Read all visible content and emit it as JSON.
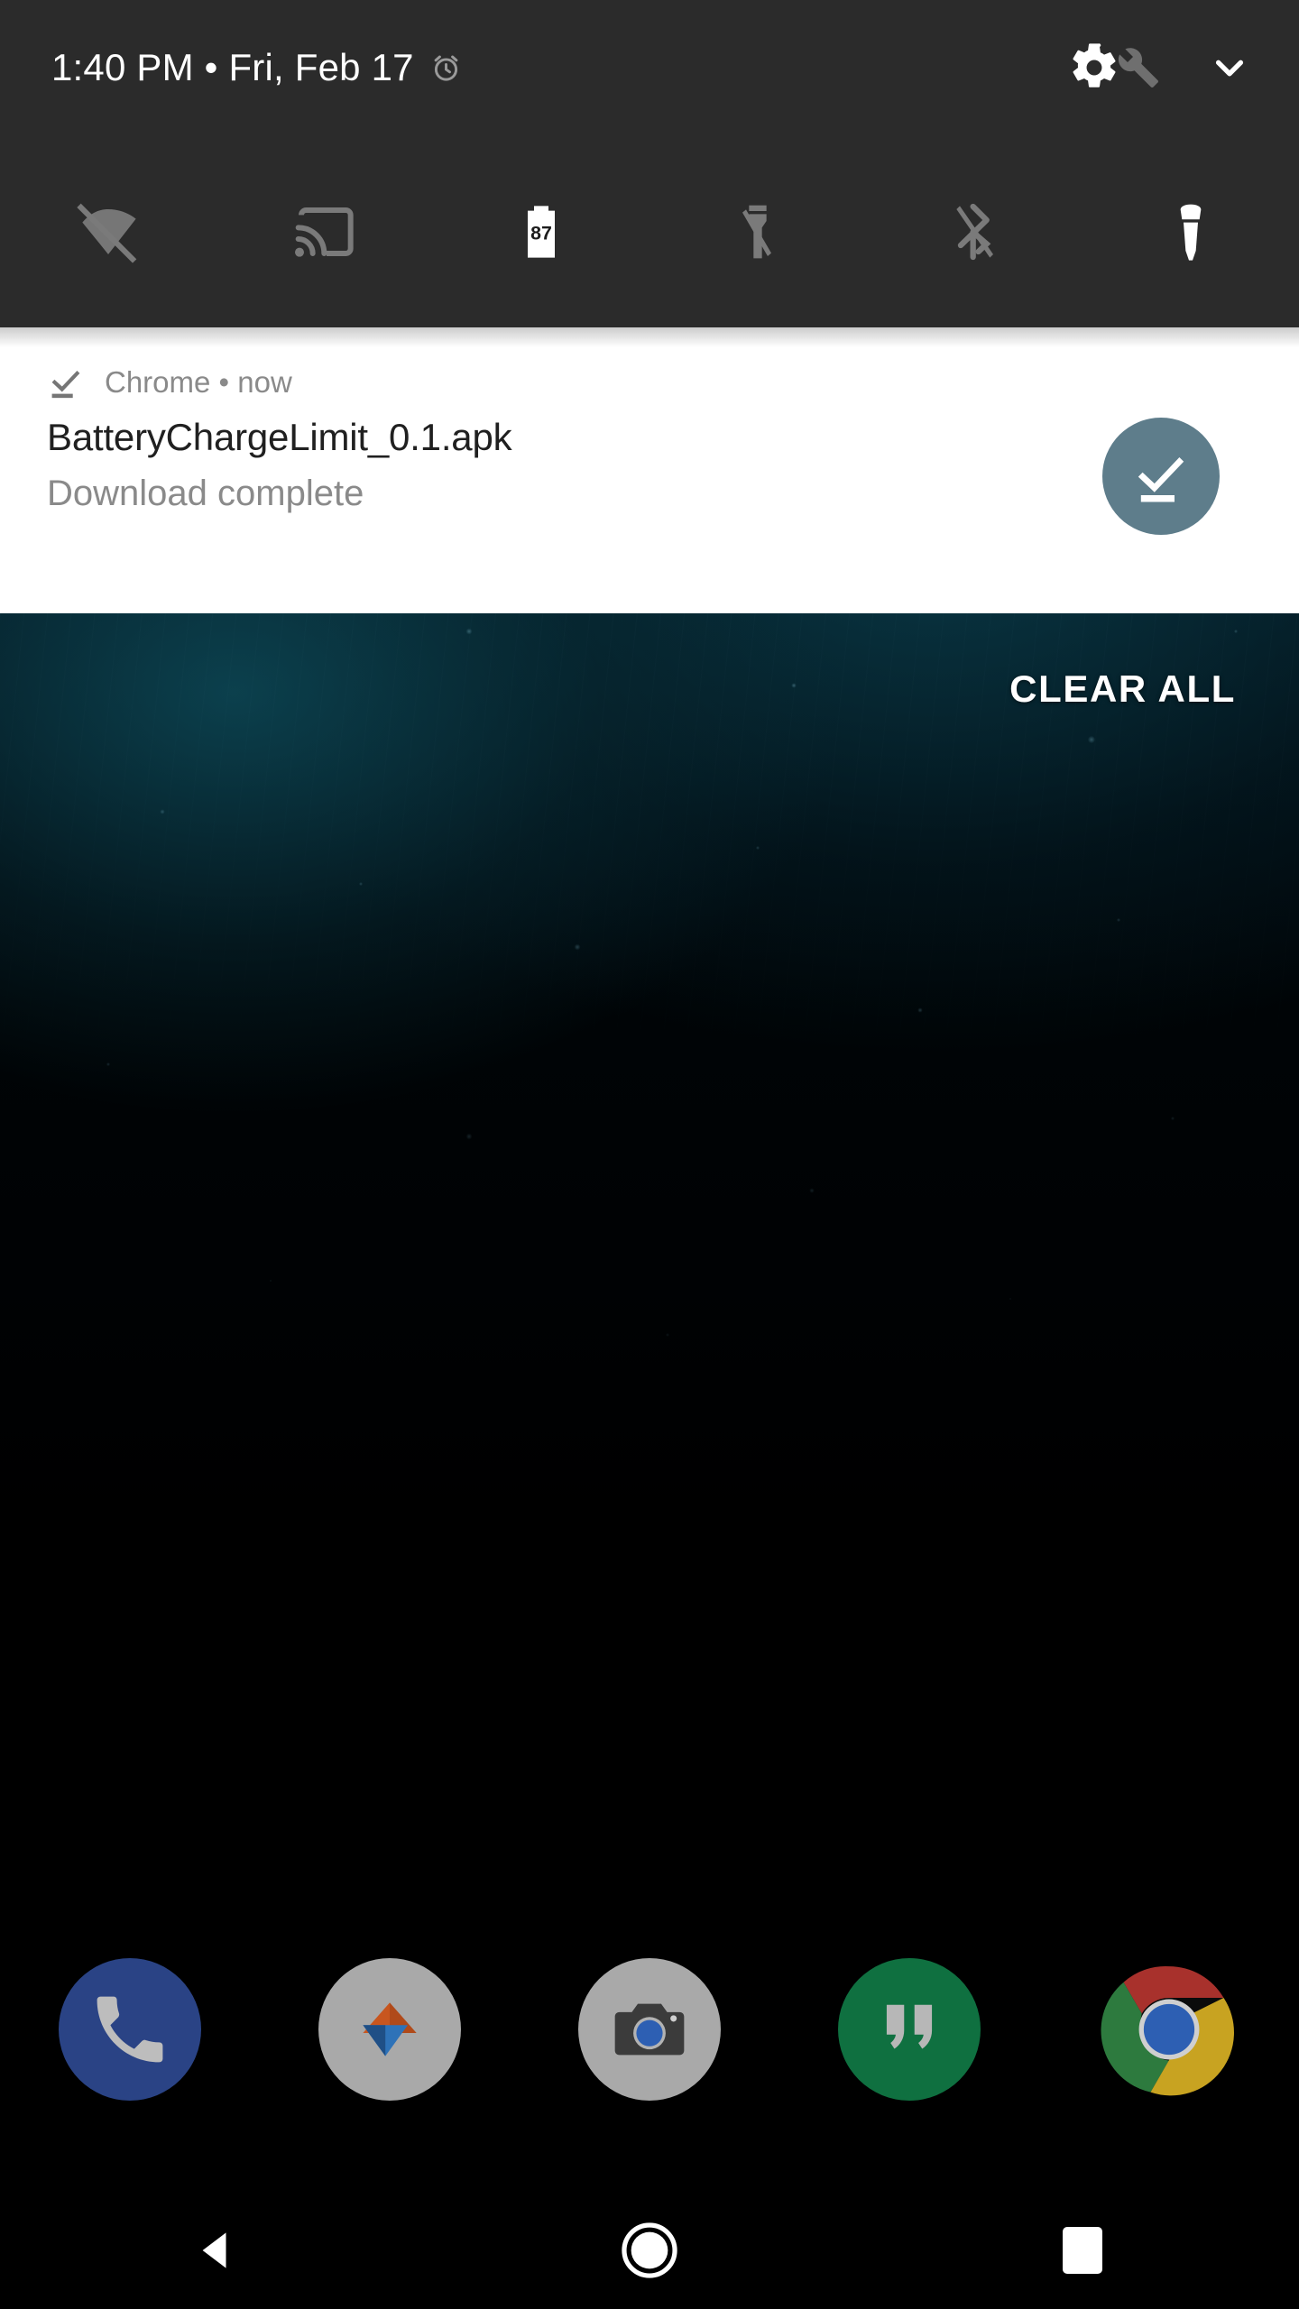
{
  "status_bar": {
    "clock": "1:40 PM • Fri, Feb 17",
    "alarm_icon": "alarm-clock-icon",
    "settings_icon": "gear-icon",
    "tuner_icon": "wrench-icon",
    "expand_icon": "chevron-down-icon",
    "text_color": "#ffffff",
    "background": "#2b2b2b"
  },
  "quick_settings": {
    "icons": [
      {
        "name": "wifi-off-icon",
        "label": "Wi-Fi off",
        "active": false,
        "color": "#7a7a7a"
      },
      {
        "name": "cast-icon",
        "label": "Cast",
        "active": false,
        "color": "#7a7a7a"
      },
      {
        "name": "battery-icon",
        "label": "Battery",
        "active": true,
        "color": "#ffffff",
        "value": "87"
      },
      {
        "name": "flashlight-off-icon",
        "label": "Flashlight off",
        "active": false,
        "color": "#7a7a7a"
      },
      {
        "name": "bluetooth-off-icon",
        "label": "Bluetooth off",
        "active": false,
        "color": "#7a7a7a"
      },
      {
        "name": "flashlight-on-icon",
        "label": "Flashlight on",
        "active": true,
        "color": "#ffffff"
      }
    ]
  },
  "notification": {
    "small_icon": "download-complete-icon",
    "app_line": "Chrome • now",
    "app_name": "Chrome",
    "time": "now",
    "title": "BatteryChargeLimit_0.1.apk",
    "text": "Download complete",
    "badge_icon": "download-complete-icon",
    "badge_color": "#5e7d8b",
    "card_background": "#ffffff",
    "title_color": "#202020",
    "text_color": "#8a8a8a"
  },
  "shade": {
    "clear_all_label": "CLEAR ALL"
  },
  "dock": {
    "items": [
      {
        "name": "dock-item-phone",
        "label": "Phone",
        "icon": "phone-icon",
        "bg": "#2a4385"
      },
      {
        "name": "dock-item-solid-explorer",
        "label": "Solid Explorer",
        "icon": "triangles-icon",
        "bg": "#a9a9a9"
      },
      {
        "name": "dock-item-camera",
        "label": "Camera",
        "icon": "camera-icon",
        "bg": "#a9a9a9"
      },
      {
        "name": "dock-item-hangouts",
        "label": "Hangouts",
        "icon": "quote-icon",
        "bg": "#0f7040"
      },
      {
        "name": "dock-item-chrome",
        "label": "Chrome",
        "icon": "chrome-icon",
        "bg": "transparent"
      }
    ]
  },
  "navigation_bar": {
    "back_label": "Back",
    "home_label": "Home",
    "recents_label": "Recents",
    "color": "#ffffff"
  }
}
